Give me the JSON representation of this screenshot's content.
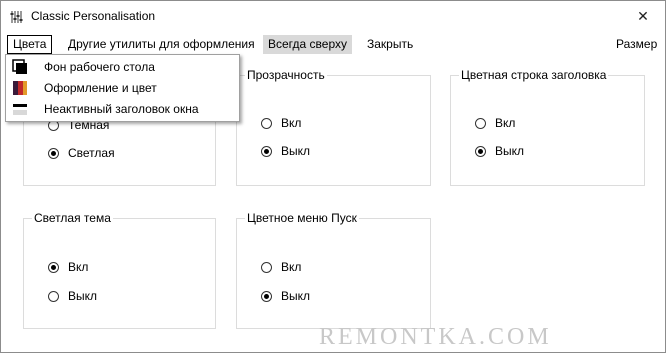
{
  "window": {
    "title": "Classic Personalisation",
    "icon": "sliders-icon",
    "close_symbol": "✕"
  },
  "menu": {
    "colors": "Цвета",
    "other_utils": "Другие утилиты для оформления",
    "always_on_top": "Всегда сверху",
    "close": "Закрыть",
    "size": "Размер"
  },
  "dropdown": {
    "items": [
      {
        "label": "Фон рабочего стола",
        "icon": "desktop-background-icon"
      },
      {
        "label": "Оформление и цвет",
        "icon": "appearance-color-icon"
      },
      {
        "label": "Неактивный заголовок окна",
        "icon": "inactive-titlebar-icon"
      }
    ]
  },
  "groups": {
    "theme": {
      "options": [
        "Темная",
        "Светлая"
      ],
      "selected": 1
    },
    "transparency": {
      "title": "Прозрачность",
      "options": [
        "Вкл",
        "Выкл"
      ],
      "selected": 1
    },
    "colored_titlebar": {
      "title": "Цветная строка заголовка",
      "options": [
        "Вкл",
        "Выкл"
      ],
      "selected": 1
    },
    "light_theme": {
      "title": "Светлая тема",
      "options": [
        "Вкл",
        "Выкл"
      ],
      "selected": 0
    },
    "colored_start": {
      "title": "Цветное меню Пуск",
      "options": [
        "Вкл",
        "Выкл"
      ],
      "selected": 1
    }
  },
  "watermark": "REMONTKA.COM"
}
